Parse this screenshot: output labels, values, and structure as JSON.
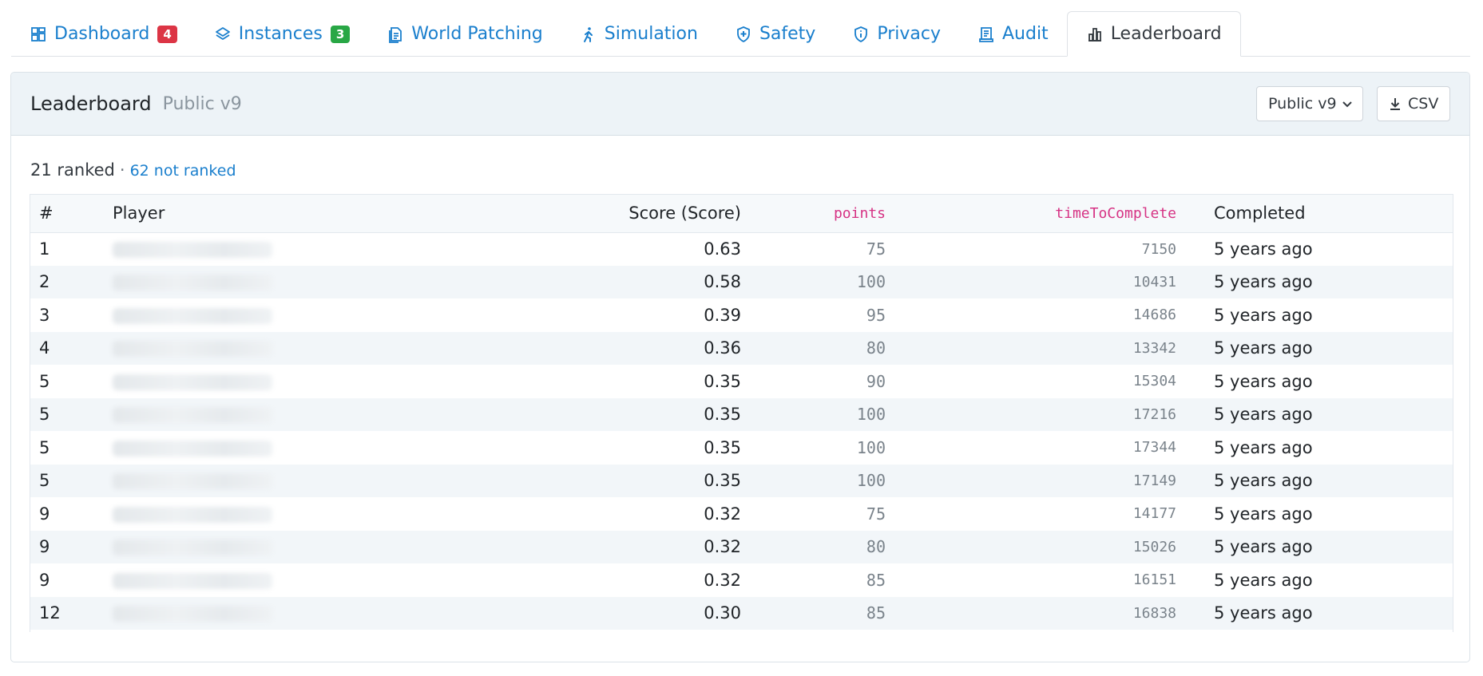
{
  "tabs": [
    {
      "label": "Dashboard",
      "icon": "dashboard-icon",
      "badge": "4",
      "badge_color": "#dc3545"
    },
    {
      "label": "Instances",
      "icon": "layers-icon",
      "badge": "3",
      "badge_color": "#28a745"
    },
    {
      "label": "World Patching",
      "icon": "document-icon"
    },
    {
      "label": "Simulation",
      "icon": "walking-person-icon"
    },
    {
      "label": "Safety",
      "icon": "shield-plus-icon"
    },
    {
      "label": "Privacy",
      "icon": "shield-info-icon"
    },
    {
      "label": "Audit",
      "icon": "receipt-icon"
    },
    {
      "label": "Leaderboard",
      "icon": "bar-chart-icon",
      "active": true
    }
  ],
  "header": {
    "title": "Leaderboard",
    "subtitle": "Public v9",
    "version_select": "Public v9",
    "csv_label": "CSV"
  },
  "summary": {
    "ranked": "21 ranked",
    "separator": "·",
    "not_ranked": "62 not ranked"
  },
  "table": {
    "columns": {
      "rank": "#",
      "player": "Player",
      "score": "Score (Score)",
      "points": "points",
      "time": "timeToComplete",
      "completed": "Completed"
    },
    "rows": [
      {
        "rank": "1",
        "score": "0.63",
        "points": "75",
        "time": "7150",
        "completed": "5 years ago"
      },
      {
        "rank": "2",
        "score": "0.58",
        "points": "100",
        "time": "10431",
        "completed": "5 years ago"
      },
      {
        "rank": "3",
        "score": "0.39",
        "points": "95",
        "time": "14686",
        "completed": "5 years ago"
      },
      {
        "rank": "4",
        "score": "0.36",
        "points": "80",
        "time": "13342",
        "completed": "5 years ago"
      },
      {
        "rank": "5",
        "score": "0.35",
        "points": "90",
        "time": "15304",
        "completed": "5 years ago"
      },
      {
        "rank": "5",
        "score": "0.35",
        "points": "100",
        "time": "17216",
        "completed": "5 years ago"
      },
      {
        "rank": "5",
        "score": "0.35",
        "points": "100",
        "time": "17344",
        "completed": "5 years ago"
      },
      {
        "rank": "5",
        "score": "0.35",
        "points": "100",
        "time": "17149",
        "completed": "5 years ago"
      },
      {
        "rank": "9",
        "score": "0.32",
        "points": "75",
        "time": "14177",
        "completed": "5 years ago"
      },
      {
        "rank": "9",
        "score": "0.32",
        "points": "80",
        "time": "15026",
        "completed": "5 years ago"
      },
      {
        "rank": "9",
        "score": "0.32",
        "points": "85",
        "time": "16151",
        "completed": "5 years ago"
      },
      {
        "rank": "12",
        "score": "0.30",
        "points": "85",
        "time": "16838",
        "completed": "5 years ago"
      }
    ]
  }
}
